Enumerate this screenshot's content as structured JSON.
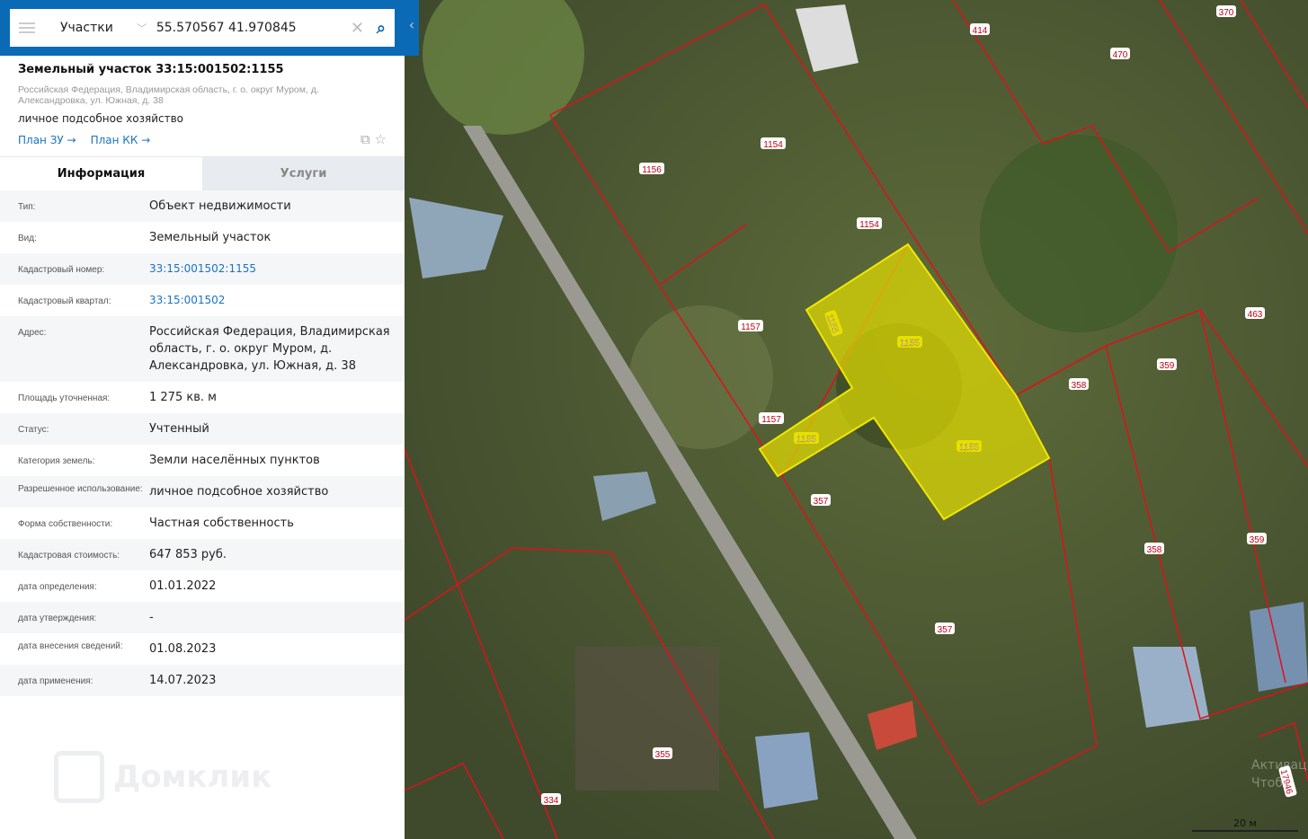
{
  "search": {
    "layer": "Участки",
    "query": "55.570567 41.970845"
  },
  "parcel": {
    "title": "Земельный участок 33:15:001502:1155",
    "address": "Российская Федерация, Владимирская область, г. о. округ Муром, д. Александровка, ул. Южная, д. 38",
    "use": "личное подсобное хозяйство",
    "link_zu": "План ЗУ →",
    "link_kk": "План КК →"
  },
  "tabs": [
    "Информация",
    "Услуги"
  ],
  "rows": [
    {
      "k": "Тип:",
      "v": "Объект недвижимости"
    },
    {
      "k": "Вид:",
      "v": "Земельный участок"
    },
    {
      "k": "Кадастровый номер:",
      "v": "33:15:001502:1155",
      "link": true
    },
    {
      "k": "Кадастровый квартал:",
      "v": "33:15:001502",
      "link": true
    },
    {
      "k": "Адрес:",
      "v": "Российская Федерация, Владимирская область, г. о. округ Муром, д. Александровка, ул. Южная, д. 38"
    },
    {
      "k": "Площадь уточненная:",
      "v": "1 275 кв. м"
    },
    {
      "k": "Статус:",
      "v": "Учтенный"
    },
    {
      "k": "Категория земель:",
      "v": "Земли населённых пунктов"
    },
    {
      "k": "Разрешенное использование:",
      "v": "личное подсобное хозяйство"
    },
    {
      "k": "Форма собственности:",
      "v": "Частная собственность"
    },
    {
      "k": "Кадастровая стоимость:",
      "v": "647 853 руб."
    },
    {
      "k": "дата определения:",
      "v": "01.01.2022"
    },
    {
      "k": "дата утверждения:",
      "v": "-"
    },
    {
      "k": "дата внесения сведений:",
      "v": "01.08.2023"
    },
    {
      "k": "дата применения:",
      "v": "14.07.2023"
    }
  ],
  "logo": "Домклик",
  "map": {
    "labels": [
      "1154",
      "1156",
      "1154",
      "1157",
      "1155",
      "1155",
      "1157",
      "1155",
      "1155",
      "357",
      "358",
      "359",
      "463",
      "358",
      "359",
      "357",
      "355",
      "334",
      "414",
      "470",
      "370",
      "17946"
    ],
    "scale": "20 м",
    "watermark": [
      "Активация",
      "Чтобы"
    ]
  }
}
